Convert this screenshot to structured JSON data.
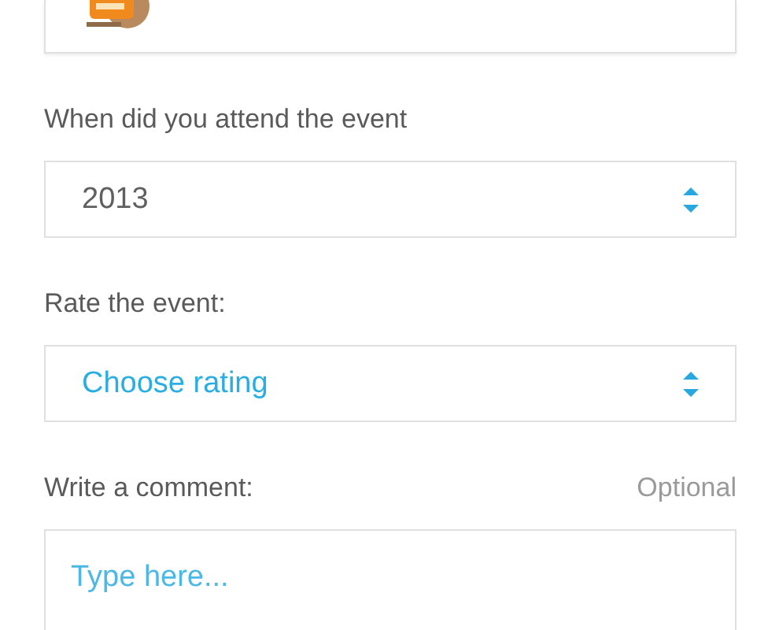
{
  "fields": [
    {
      "kind": "select",
      "label": "When did you attend the event",
      "value": "2013"
    },
    {
      "kind": "select",
      "label": "Rate the event:",
      "placeholder": "Choose rating"
    },
    {
      "kind": "textarea",
      "label": "Write a comment:",
      "note": "Optional",
      "placeholder": "Type here..."
    }
  ]
}
